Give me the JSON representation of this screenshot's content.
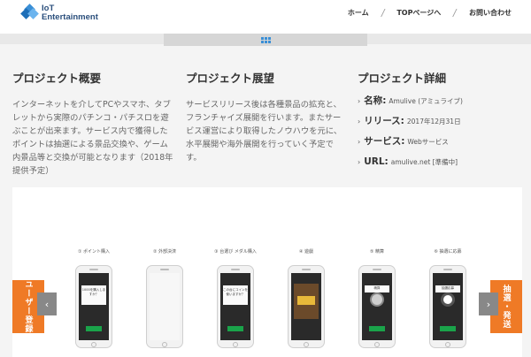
{
  "header": {
    "logo_line1": "IoT",
    "logo_line2": "Entertainment",
    "nav": {
      "home": "ホーム",
      "top": "TOPページへ",
      "contact": "お問い合わせ"
    },
    "separator": "/"
  },
  "band": {
    "icon": "grid-icon"
  },
  "overview": {
    "title": "プロジェクト概要",
    "text": "インターネットを介してPCやスマホ、タブレットから実際のパチンコ・パチスロを遊ぶことが出来ます。サービス内で獲得したポイントは抽選による景品交換や、ゲーム内景品等と交換が可能となります（2018年提供予定）"
  },
  "outlook": {
    "title": "プロジェクト展望",
    "text": "サービスリリース後は各種景品の拡充と、フランチャイズ展開を行います。またサービス運営により取得したノウハウを元に、水平展開や海外展開を行っていく予定です。"
  },
  "details": {
    "title": "プロジェクト詳細",
    "arrow": "›",
    "items": [
      {
        "key": "名称:",
        "value": "Amulive (アミュライブ)"
      },
      {
        "key": "リリース:",
        "value": "2017年12月31日"
      },
      {
        "key": "サービス:",
        "value": "Webサービス"
      },
      {
        "key": "URL:",
        "value": "amulive.net [準備中]"
      }
    ]
  },
  "showcase": {
    "left_tab": "ユーザー登録",
    "right_tab": "抽選・発送",
    "prev": "‹",
    "next": "›",
    "steps": [
      {
        "label": "① ポイント購入"
      },
      {
        "label": "② 外部決済"
      },
      {
        "label": "③ 台選び メダル購入"
      },
      {
        "label": "④ 遊戯"
      },
      {
        "label": "⑤ 精算"
      },
      {
        "label": "⑥ 抽選に応募"
      }
    ],
    "screens": {
      "s1": "1000を購入しますか？",
      "s3": "この台にコインを使いますか？",
      "s5": "精算",
      "s6": "抽選応募"
    }
  },
  "colors": {
    "accent": "#ef7a26",
    "brand": "#3a8fd6"
  }
}
